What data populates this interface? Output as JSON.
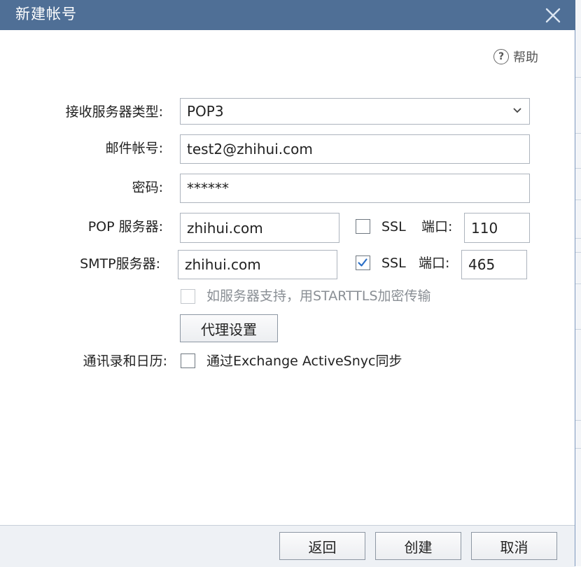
{
  "window": {
    "title": "新建帐号",
    "close_icon": "close-icon"
  },
  "help": {
    "label": "帮助",
    "icon_glyph": "?"
  },
  "form": {
    "server_type": {
      "label": "接收服务器类型:",
      "value": "POP3"
    },
    "email": {
      "label": "邮件帐号:",
      "value": "test2@zhihui.com"
    },
    "password": {
      "label": "密码:",
      "value": "******"
    },
    "pop": {
      "label": "POP 服务器:",
      "value": "zhihui.com",
      "ssl_label": "SSL",
      "ssl_checked": false,
      "port_label": "端口:",
      "port_value": "110"
    },
    "smtp": {
      "label": "SMTP服务器:",
      "value": "zhihui.com",
      "ssl_label": "SSL",
      "ssl_checked": true,
      "port_label": "端口:",
      "port_value": "465"
    },
    "starttls": {
      "label": "如服务器支持，用STARTTLS加密传输",
      "checked": false,
      "disabled": true
    },
    "proxy_button": "代理设置",
    "contacts": {
      "label": "通讯录和日历:",
      "option": "通过Exchange ActiveSnyc同步",
      "checked": false
    }
  },
  "footer": {
    "back": "返回",
    "create": "创建",
    "cancel": "取消"
  },
  "colors": {
    "titlebar": "#4f6f96",
    "check": "#2b6fc7",
    "footer": "#eef1f5"
  }
}
